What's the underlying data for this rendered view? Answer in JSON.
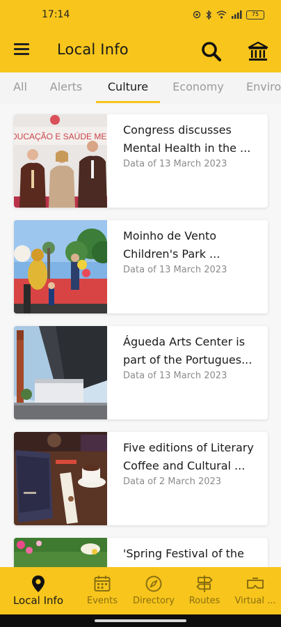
{
  "status_bar": {
    "time": "17:14",
    "battery": "75"
  },
  "header": {
    "title": "Local Info"
  },
  "tabs": [
    {
      "label": "All"
    },
    {
      "label": "Alerts"
    },
    {
      "label": "Culture",
      "active": true
    },
    {
      "label": "Economy"
    },
    {
      "label": "Enviro"
    }
  ],
  "articles": [
    {
      "title": "Congress discusses Mental Health in the ...",
      "date": "Data of 13 March 2023",
      "image_text": "DUCAÇÃO E SAÚDE MEN"
    },
    {
      "title": "Moinho de Vento Children's Park ...",
      "date": "Data of 13 March 2023"
    },
    {
      "title": "Águeda Arts Center is part of the Portugues...",
      "date": "Data of 13 March 2023"
    },
    {
      "title": "Five editions of Literary Coffee and Cultural ...",
      "date": "Data of 2 March 2023"
    },
    {
      "title": "'Spring Festival of the Flower'",
      "date": ""
    }
  ],
  "bottom_nav": [
    {
      "label": "Local Info",
      "icon": "location-pin-icon",
      "active": true
    },
    {
      "label": "Events",
      "icon": "calendar-icon"
    },
    {
      "label": "Directory",
      "icon": "compass-icon"
    },
    {
      "label": "Routes",
      "icon": "signpost-icon"
    },
    {
      "label": "Virtual ...",
      "icon": "vr-headset-icon"
    }
  ],
  "colors": {
    "accent": "#f7c51c",
    "tab_inactive": "#9a9a9a",
    "date_text": "#8a8a8a"
  }
}
